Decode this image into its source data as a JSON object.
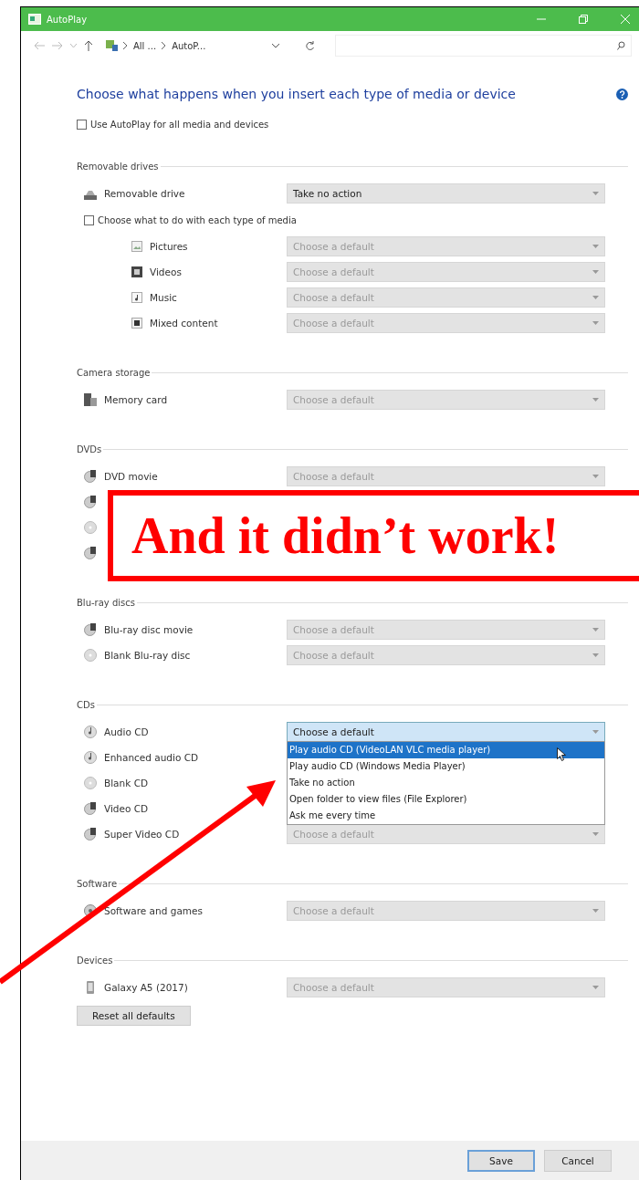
{
  "window": {
    "title": "AutoPlay"
  },
  "address_bar": {
    "breadcrumbs": [
      "All ...",
      "AutoP..."
    ]
  },
  "heading": "Choose what happens when you insert each type of media or device",
  "use_autoplay": {
    "label": "Use AutoPlay for all media and devices",
    "checked": false
  },
  "sections": [
    {
      "title": "Removable drives",
      "items": [
        {
          "kind": "drive",
          "label": "Removable drive",
          "value": "Take no action",
          "disabled": false,
          "focused": false
        },
        {
          "kind": "checkbox",
          "label": "Choose what to do with each type of media",
          "checked": false,
          "children": [
            {
              "kind": "picture",
              "label": "Pictures",
              "value": "Choose a default",
              "disabled": true,
              "focused": false
            },
            {
              "kind": "video",
              "label": "Videos",
              "value": "Choose a default",
              "disabled": true,
              "focused": false
            },
            {
              "kind": "music",
              "label": "Music",
              "value": "Choose a default",
              "disabled": true,
              "focused": false
            },
            {
              "kind": "mixed",
              "label": "Mixed content",
              "value": "Choose a default",
              "disabled": true,
              "focused": false
            }
          ]
        }
      ]
    },
    {
      "title": "Camera storage",
      "items": [
        {
          "kind": "card",
          "label": "Memory card",
          "value": "Choose a default",
          "disabled": true,
          "focused": false
        }
      ]
    },
    {
      "title": "DVDs",
      "items": [
        {
          "kind": "movie-disc",
          "label": "DVD movie",
          "value": "Choose a default",
          "disabled": true,
          "focused": false
        },
        {
          "kind": "movie-disc"
        },
        {
          "kind": "blank-disc"
        },
        {
          "kind": "movie-disc"
        }
      ]
    },
    {
      "title": "Blu-ray discs",
      "items": [
        {
          "kind": "movie-disc",
          "label": "Blu-ray disc movie",
          "value": "Choose a default",
          "disabled": true,
          "focused": false
        },
        {
          "kind": "blank-disc",
          "label": "Blank Blu-ray disc",
          "value": "Choose a default",
          "disabled": true,
          "focused": false
        }
      ]
    },
    {
      "title": "CDs",
      "items": [
        {
          "kind": "music-disc",
          "label": "Audio CD",
          "value": "Choose a default",
          "disabled": false,
          "focused": true,
          "options": [
            {
              "label": "Play audio CD (VideoLAN VLC media player)",
              "selected": true
            },
            {
              "label": "Play audio CD (Windows Media Player)",
              "selected": false
            },
            {
              "label": "Take no action",
              "selected": false
            },
            {
              "label": "Open folder to view files (File Explorer)",
              "selected": false
            },
            {
              "label": "Ask me every time",
              "selected": false
            }
          ]
        },
        {
          "kind": "music-disc",
          "label": "Enhanced audio CD"
        },
        {
          "kind": "blank-disc",
          "label": "Blank CD"
        },
        {
          "kind": "movie-disc",
          "label": "Video CD"
        },
        {
          "kind": "movie-disc",
          "label": "Super Video CD",
          "value": "Choose a default",
          "disabled": true,
          "focused": false
        }
      ]
    },
    {
      "title": "Software",
      "items": [
        {
          "kind": "software",
          "label": "Software and games",
          "value": "Choose a default",
          "disabled": true,
          "focused": false
        }
      ]
    },
    {
      "title": "Devices",
      "items": [
        {
          "kind": "phone",
          "label": "Galaxy A5 (2017)",
          "value": "Choose a default",
          "disabled": true,
          "focused": false
        }
      ]
    }
  ],
  "reset_button": "Reset all defaults",
  "footer_buttons": [
    {
      "label": "Save",
      "default": true
    },
    {
      "label": "Cancel",
      "default": false
    }
  ],
  "annotation": {
    "text": "And it didn’t work!"
  }
}
